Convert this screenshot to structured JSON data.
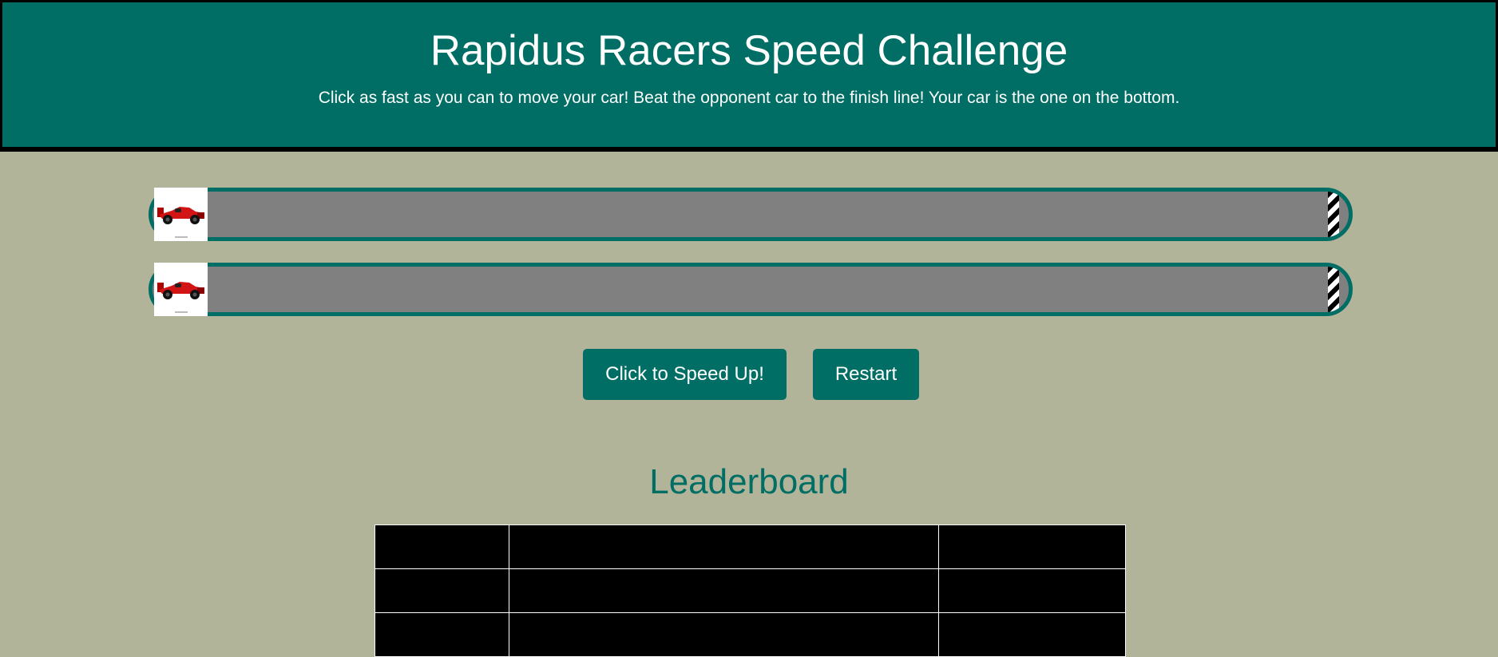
{
  "header": {
    "title": "Rapidus Racers Speed Challenge",
    "subtitle": "Click as fast as you can to move your car! Beat the opponent car to the finish line! Your car is the one on the bottom."
  },
  "race": {
    "opponent_car": {
      "icon": "red-race-car-icon",
      "progress": 0
    },
    "player_car": {
      "icon": "red-race-car-icon",
      "progress": 0
    },
    "finish_line_icon": "checkered-finish-line-icon"
  },
  "controls": {
    "speed_up_label": "Click to Speed Up!",
    "restart_label": "Restart"
  },
  "leaderboard": {
    "title": "Leaderboard",
    "rows": [
      [
        "",
        "",
        ""
      ],
      [
        "",
        "",
        ""
      ],
      [
        "",
        "",
        ""
      ]
    ]
  },
  "colors": {
    "accent": "#006e64",
    "background": "#b2b49a",
    "track": "#808080"
  }
}
